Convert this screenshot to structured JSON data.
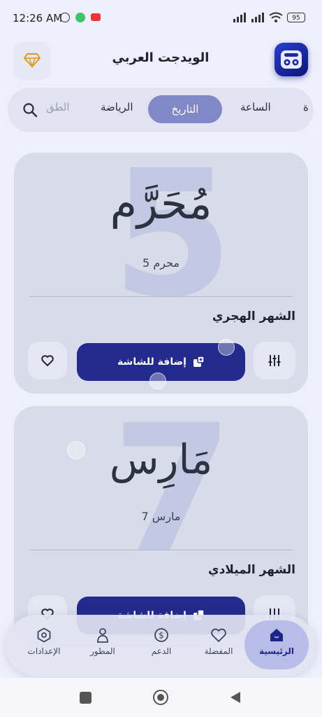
{
  "status_bar": {
    "time": "12:26 AM",
    "battery": "95"
  },
  "header": {
    "title": "الويدجت العربي"
  },
  "tabs": {
    "items": [
      {
        "label": "ة",
        "state": "partial"
      },
      {
        "label": "الساعة",
        "state": "normal"
      },
      {
        "label": "التاريخ",
        "state": "active"
      },
      {
        "label": "الرياضة",
        "state": "normal"
      },
      {
        "label": "الطق",
        "state": "faded"
      }
    ]
  },
  "cards": [
    {
      "big_number": "5",
      "calligraphy": "مُحَرَّم",
      "subtitle": "5 محرم",
      "category": "الشهر الهجري",
      "add_label": "إضافة للشاشة"
    },
    {
      "big_number": "7",
      "calligraphy": "مَارِس",
      "subtitle": "7 مارس",
      "category": "الشهر الميلادي",
      "add_label": "إضافة للشاشة"
    }
  ],
  "bottom_nav": {
    "items": [
      {
        "label": "الرئيسية",
        "icon": "home-icon",
        "active": true
      },
      {
        "label": "المفضلة",
        "icon": "heart-icon",
        "active": false
      },
      {
        "label": "الدعم",
        "icon": "dollar-icon",
        "active": false
      },
      {
        "label": "المطور",
        "icon": "person-icon",
        "active": false
      },
      {
        "label": "الإعدادات",
        "icon": "settings-icon",
        "active": false
      }
    ]
  },
  "colors": {
    "accent": "#222a8d",
    "active_tab": "#8088c6",
    "card_bg": "#d7dbea",
    "page_bg": "#eeeffb"
  }
}
